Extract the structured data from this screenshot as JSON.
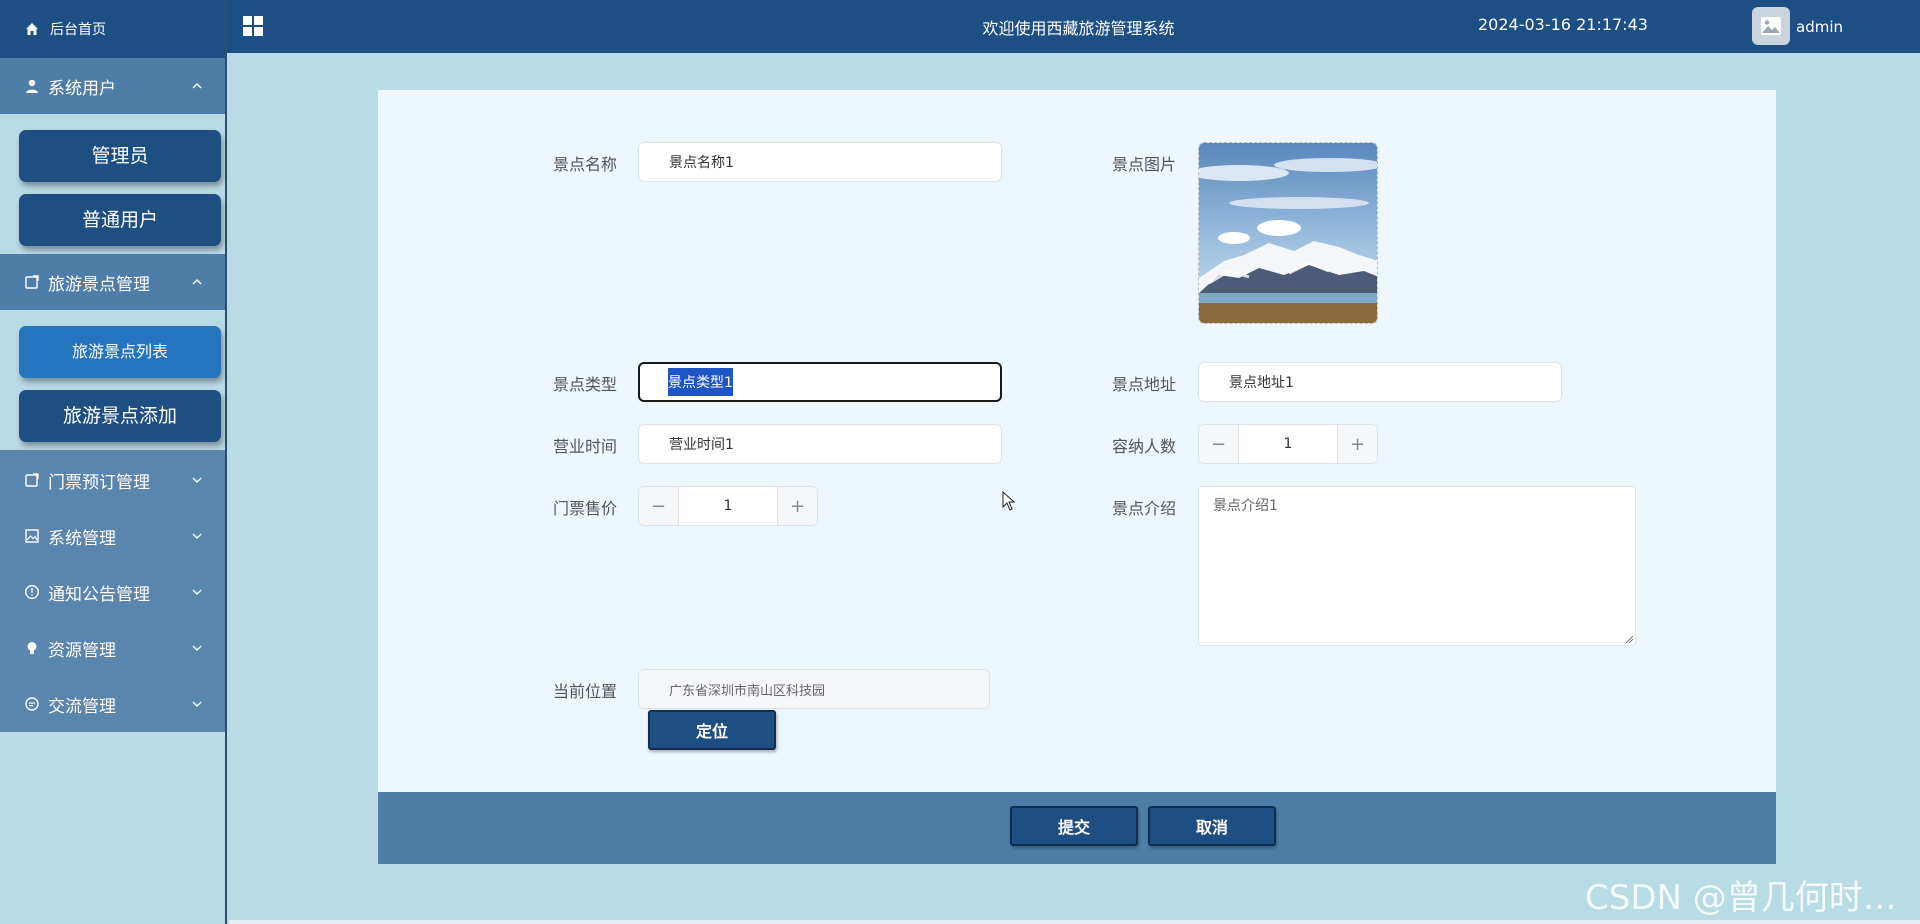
{
  "colors": {
    "primary": "#1d4f84",
    "active_submenu": "#2475bd",
    "group_header": "#4e7ea8",
    "page_bg": "#b9dbe6",
    "panel_bg": "#eef6fe"
  },
  "sidebar": {
    "home": {
      "label": "后台首页",
      "icon": "home-icon"
    },
    "groups": [
      {
        "label": "系统用户",
        "icon": "user-icon",
        "expanded": true,
        "items": [
          "管理员",
          "普通用户"
        ]
      },
      {
        "label": "旅游景点管理",
        "icon": "folder-icon",
        "expanded": true,
        "items": [
          "旅游景点列表",
          "旅游景点添加"
        ],
        "active_item": "旅游景点列表"
      },
      {
        "label": "门票预订管理",
        "icon": "folder-icon",
        "expanded": false
      },
      {
        "label": "系统管理",
        "icon": "image-icon",
        "expanded": false
      },
      {
        "label": "通知公告管理",
        "icon": "info-icon",
        "expanded": false
      },
      {
        "label": "资源管理",
        "icon": "bulb-icon",
        "expanded": false
      },
      {
        "label": "交流管理",
        "icon": "chat-icon",
        "expanded": false
      }
    ]
  },
  "topbar": {
    "title": "欢迎使用西藏旅游管理系统",
    "datetime": "2024-03-16 21:17:43",
    "username": "admin"
  },
  "form": {
    "name": {
      "label": "景点名称",
      "value": "景点名称1"
    },
    "image": {
      "label": "景点图片"
    },
    "type": {
      "label": "景点类型",
      "value": "景点类型1"
    },
    "address": {
      "label": "景点地址",
      "value": "景点地址1"
    },
    "hours": {
      "label": "营业时间",
      "value": "营业时间1"
    },
    "capacity": {
      "label": "容纳人数",
      "value": "1"
    },
    "price": {
      "label": "门票售价",
      "value": "1"
    },
    "intro": {
      "label": "景点介绍",
      "value": "景点介绍1"
    },
    "location": {
      "label": "当前位置",
      "value": "广东省深圳市南山区科技园",
      "locate_button": "定位"
    }
  },
  "actions": {
    "submit": "提交",
    "cancel": "取消"
  },
  "watermark": "CSDN @曾几何时…"
}
